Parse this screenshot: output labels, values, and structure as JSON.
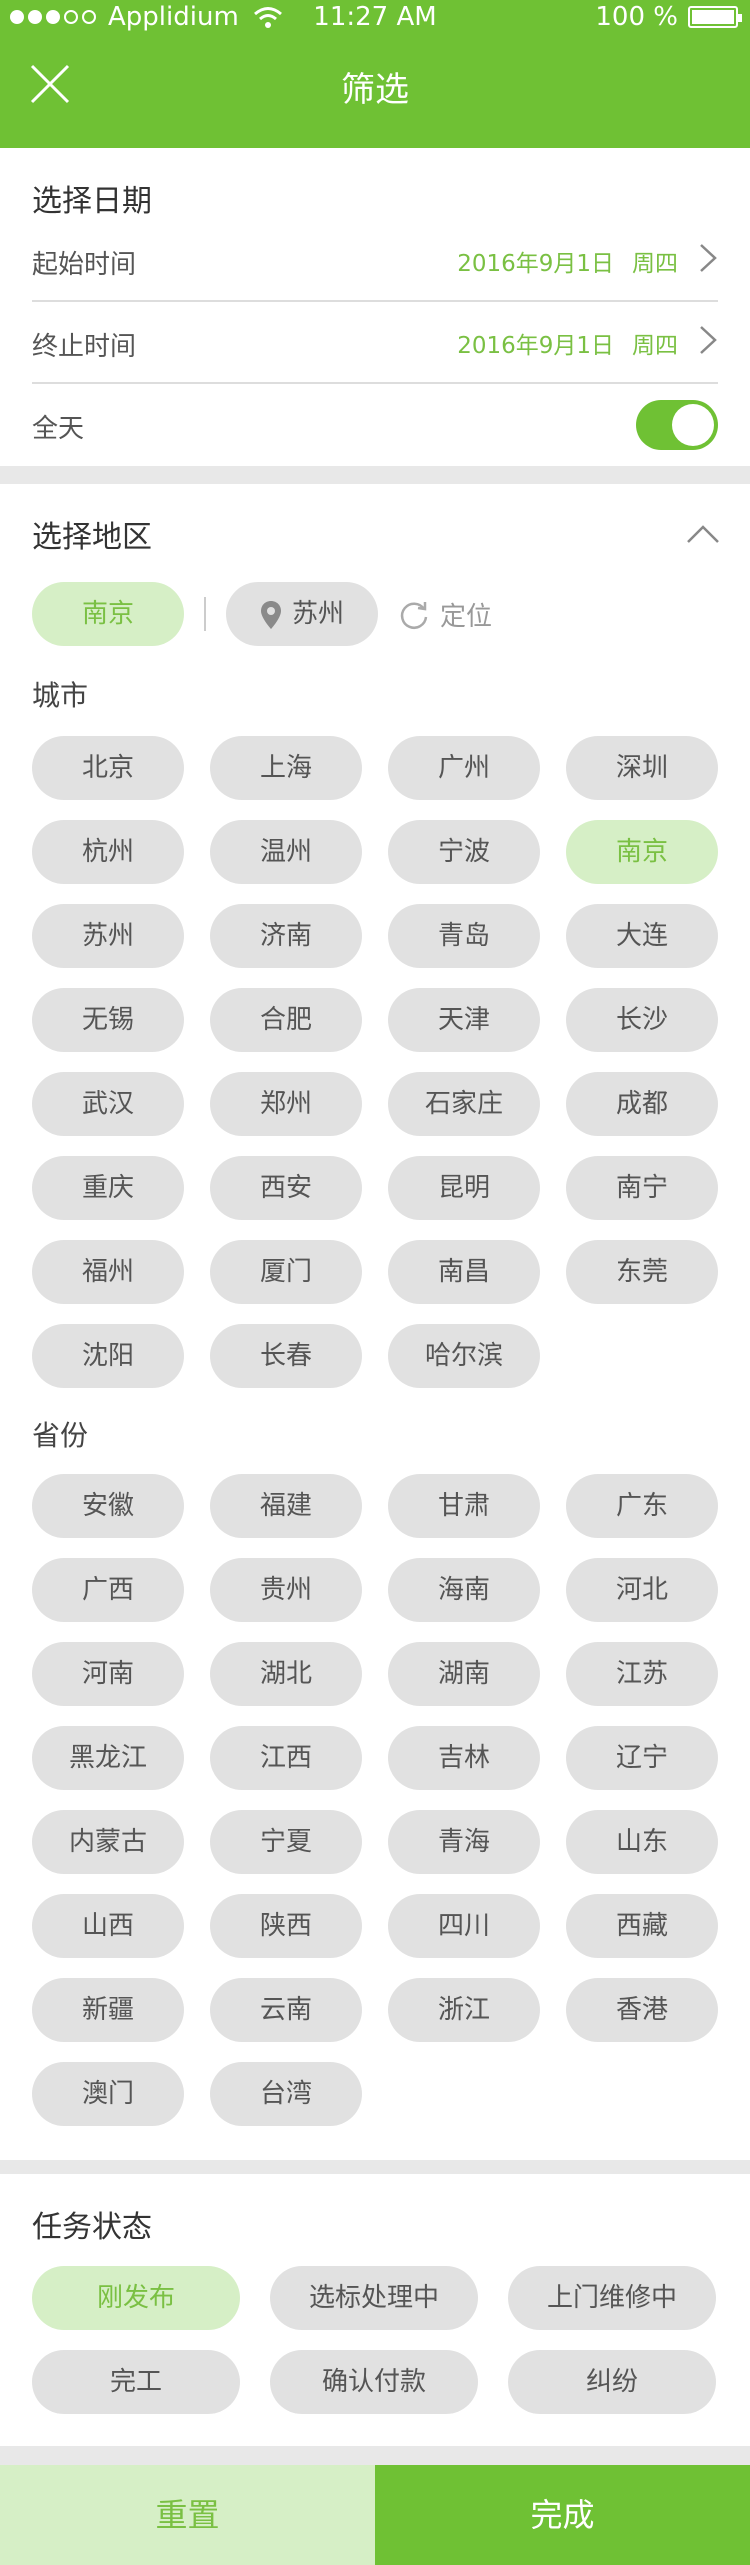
{
  "status_bar": {
    "carrier": "Applidium",
    "time": "11:27 AM",
    "battery": "100 %"
  },
  "header": {
    "title": "筛选"
  },
  "date_section": {
    "heading": "选择日期",
    "start": {
      "label": "起始时间",
      "date": "2016年9月1日",
      "weekday": "周四"
    },
    "end": {
      "label": "终止时间",
      "date": "2016年9月1日",
      "weekday": "周四"
    },
    "allday": {
      "label": "全天",
      "on": true
    }
  },
  "region_section": {
    "heading": "选择地区",
    "selected_city": "南京",
    "current_city": "苏州",
    "locate_label": "定位",
    "cities_heading": "城市",
    "cities": [
      "北京",
      "上海",
      "广州",
      "深圳",
      "杭州",
      "温州",
      "宁波",
      "南京",
      "苏州",
      "济南",
      "青岛",
      "大连",
      "无锡",
      "合肥",
      "天津",
      "长沙",
      "武汉",
      "郑州",
      "石家庄",
      "成都",
      "重庆",
      "西安",
      "昆明",
      "南宁",
      "福州",
      "厦门",
      "南昌",
      "东莞",
      "沈阳",
      "长春",
      "哈尔滨"
    ],
    "provinces_heading": "省份",
    "provinces": [
      "安徽",
      "福建",
      "甘肃",
      "广东",
      "广西",
      "贵州",
      "海南",
      "河北",
      "河南",
      "湖北",
      "湖南",
      "江苏",
      "黑龙江",
      "江西",
      "吉林",
      "辽宁",
      "内蒙古",
      "宁夏",
      "青海",
      "山东",
      "山西",
      "陕西",
      "四川",
      "西藏",
      "新疆",
      "云南",
      "浙江",
      "香港",
      "澳门",
      "台湾"
    ]
  },
  "status_section": {
    "heading": "任务状态",
    "options": [
      "刚发布",
      "选标处理中",
      "上门维修中",
      "完工",
      "确认付款",
      "纠纷"
    ],
    "selected": "刚发布"
  },
  "bottom": {
    "reset_label": "重置",
    "done_label": "完成"
  },
  "colors": {
    "accent": "#6fc134",
    "accent_light": "#d6efc6",
    "accent_text": "#7ac043",
    "pill_gray": "#e1e1e1"
  }
}
